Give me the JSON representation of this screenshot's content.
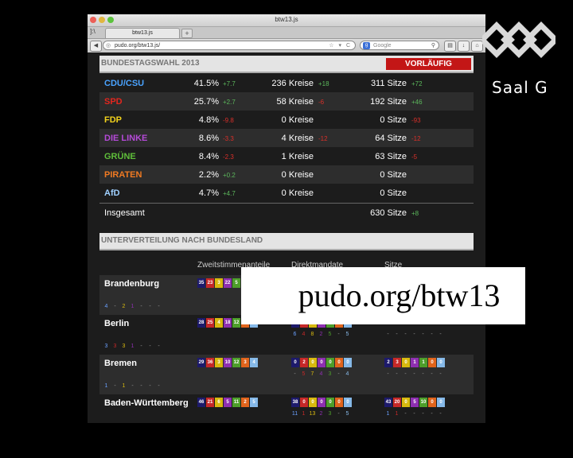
{
  "window": {
    "title": "btw13.js"
  },
  "tab": {
    "label": "btw13.js",
    "new_tab": "+",
    "glyph": "]:\\"
  },
  "address": {
    "url": "pudo.org/btw13.js/",
    "search_placeholder": "Google"
  },
  "header": {
    "title": "BUNDESTAGSWAHL 2013",
    "badge": "VORLÄUFIG"
  },
  "parties": [
    {
      "name": "CDU/CSU",
      "color": "#4aa3ff",
      "pct": "41.5%",
      "pct_delta": "+7.7",
      "pct_delta_color": "#5cb85c",
      "kreise": "236 Kreise",
      "kreise_delta": "+18",
      "kreise_delta_color": "#5cb85c",
      "sitze": "311 Sitze",
      "sitze_delta": "+72",
      "sitze_delta_color": "#5cb85c"
    },
    {
      "name": "SPD",
      "color": "#e3261e",
      "pct": "25.7%",
      "pct_delta": "+2.7",
      "pct_delta_color": "#5cb85c",
      "kreise": "58 Kreise",
      "kreise_delta": "-6",
      "kreise_delta_color": "#d9302a",
      "sitze": "192 Sitze",
      "sitze_delta": "+46",
      "sitze_delta_color": "#5cb85c"
    },
    {
      "name": "FDP",
      "color": "#f2d21b",
      "pct": "4.8%",
      "pct_delta": "-9.8",
      "pct_delta_color": "#d9302a",
      "kreise": "0 Kreise",
      "kreise_delta": "",
      "kreise_delta_color": "#fff",
      "sitze": "0 Sitze",
      "sitze_delta": "-93",
      "sitze_delta_color": "#d9302a"
    },
    {
      "name": "DIE LINKE",
      "color": "#b54ad8",
      "pct": "8.6%",
      "pct_delta": "-3.3",
      "pct_delta_color": "#d9302a",
      "kreise": "4 Kreise",
      "kreise_delta": "-12",
      "kreise_delta_color": "#d9302a",
      "sitze": "64 Sitze",
      "sitze_delta": "-12",
      "sitze_delta_color": "#d9302a"
    },
    {
      "name": "GRÜNE",
      "color": "#5fbf3a",
      "pct": "8.4%",
      "pct_delta": "-2.3",
      "pct_delta_color": "#d9302a",
      "kreise": "1 Kreise",
      "kreise_delta": "",
      "kreise_delta_color": "#fff",
      "sitze": "63 Sitze",
      "sitze_delta": "-5",
      "sitze_delta_color": "#d9302a"
    },
    {
      "name": "PIRATEN",
      "color": "#f07a22",
      "pct": "2.2%",
      "pct_delta": "+0.2",
      "pct_delta_color": "#5cb85c",
      "kreise": "0 Kreise",
      "kreise_delta": "",
      "kreise_delta_color": "#fff",
      "sitze": "0 Sitze",
      "sitze_delta": "",
      "sitze_delta_color": "#fff"
    },
    {
      "name": "AfD",
      "color": "#9fd0ff",
      "pct": "4.7%",
      "pct_delta": "+4.7",
      "pct_delta_color": "#5cb85c",
      "kreise": "0 Kreise",
      "kreise_delta": "",
      "kreise_delta_color": "#fff",
      "sitze": "0 Sitze",
      "sitze_delta": "",
      "sitze_delta_color": "#fff"
    }
  ],
  "total": {
    "label": "Insgesamt",
    "sitze": "630 Sitze",
    "sitze_delta": "+8"
  },
  "section2": {
    "title": "UNTERVERTEILUNG NACH BUNDESLAND",
    "col1": "Zweitstimmenanteile",
    "col2": "Direktmandate",
    "col3": "Sitze"
  },
  "box_colors": [
    "#1d1a6b",
    "#c62828",
    "#d8b90f",
    "#8e2fb0",
    "#4d9e2a",
    "#e0641c",
    "#86b9e8"
  ],
  "states": [
    {
      "name": "Brandenburg",
      "shares": [
        "35",
        "23",
        "3",
        "22",
        "5",
        "",
        ""
      ],
      "share_deltas": [
        "4",
        "-",
        "2",
        "1",
        "-",
        "-",
        "-"
      ],
      "direct": [],
      "direct_deltas": [],
      "seats": [],
      "seat_deltas": []
    },
    {
      "name": "Berlin",
      "shares": [
        "28",
        "25",
        "4",
        "18",
        "12",
        "4",
        "5"
      ],
      "share_deltas": [
        "3",
        "3",
        "3",
        "1",
        "-",
        "-",
        "-"
      ],
      "direct": [
        "5",
        "0",
        "0",
        "0",
        "0",
        "0",
        "0"
      ],
      "direct_deltas": [
        "6",
        "4",
        "8",
        "2",
        "5",
        "-",
        "5"
      ],
      "seats": [],
      "seat_deltas": [
        "-",
        "-",
        "-",
        "-",
        "-",
        "-",
        "-"
      ]
    },
    {
      "name": "Bremen",
      "shares": [
        "29",
        "36",
        "3",
        "10",
        "12",
        "3",
        "4"
      ],
      "share_deltas": [
        "1",
        "-",
        "1",
        "-",
        "-",
        "-",
        "-"
      ],
      "direct": [
        "0",
        "2",
        "0",
        "0",
        "0",
        "0",
        "0"
      ],
      "direct_deltas": [
        "-",
        "5",
        "7",
        "4",
        "3",
        "-",
        "4"
      ],
      "seats": [
        "2",
        "3",
        "0",
        "1",
        "1",
        "0",
        "0"
      ],
      "seat_deltas": [
        "-",
        "-",
        "-",
        "-",
        "-",
        "-",
        "-"
      ]
    },
    {
      "name": "Baden-Württemberg",
      "shares": [
        "46",
        "21",
        "6",
        "5",
        "11",
        "2",
        "5"
      ],
      "share_deltas": [],
      "direct": [
        "38",
        "0",
        "0",
        "0",
        "0",
        "0",
        "0"
      ],
      "direct_deltas": [
        "11",
        "1",
        "13",
        "2",
        "3",
        "-",
        "5"
      ],
      "seats": [
        "43",
        "20",
        "0",
        "5",
        "10",
        "0",
        "0"
      ],
      "seat_deltas": [
        "1",
        "1",
        "-",
        "-",
        "-",
        "-",
        "-"
      ]
    }
  ],
  "overlay": {
    "text": "pudo.org/btw13"
  },
  "logo": {
    "text": "Saal G"
  }
}
